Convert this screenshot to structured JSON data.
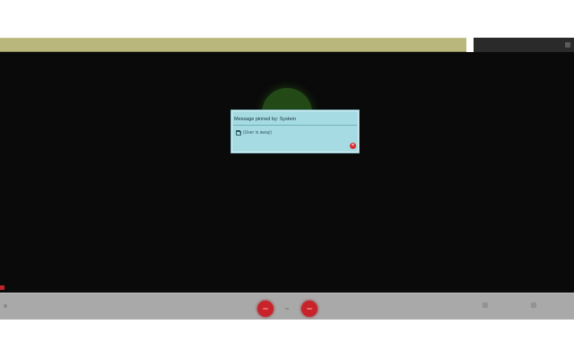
{
  "top_bar": {
    "text": ""
  },
  "top_right": {
    "items": [
      "",
      ""
    ]
  },
  "dialog": {
    "title": "Message pinned by: System",
    "body": "(User is away)"
  },
  "bottom_bar": {
    "left_label": "",
    "left_label_2": "",
    "right_text": "",
    "right_items": [
      {
        "label": ""
      },
      {
        "label": ""
      }
    ]
  },
  "colors": {
    "dialog_bg": "#a6dbe3",
    "top_bar_bg": "#b9b77c",
    "stage_bg": "#0a0a0a",
    "call_button": "#c8232a",
    "bottom_bar_bg": "#a9a9a9"
  },
  "icons": {
    "dialog_row": "folder-icon",
    "dialog_close": "close-icon"
  }
}
